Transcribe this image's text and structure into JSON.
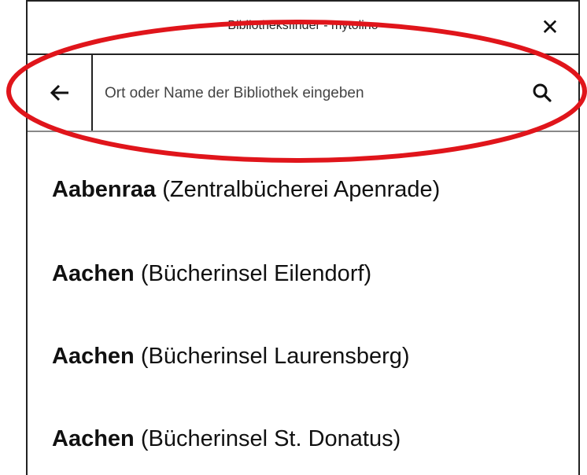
{
  "window": {
    "title": "Bibliotheksfinder - mytolino",
    "close_icon": "close-icon"
  },
  "search": {
    "back_icon": "arrow-left-icon",
    "placeholder": "Ort oder Name der Bibliothek eingeben",
    "value": "",
    "search_icon": "search-icon"
  },
  "results": [
    {
      "city": "Aabenraa",
      "library": "(Zentralbücherei Apenrade)"
    },
    {
      "city": "Aachen",
      "library": "(Bücherinsel Eilendorf)"
    },
    {
      "city": "Aachen",
      "library": "(Bücherinsel Laurensberg)"
    },
    {
      "city": "Aachen",
      "library": "(Bücherinsel St. Donatus)"
    }
  ],
  "annotation": {
    "shape": "ellipse",
    "color": "#e0151b",
    "target": "search-bar"
  }
}
